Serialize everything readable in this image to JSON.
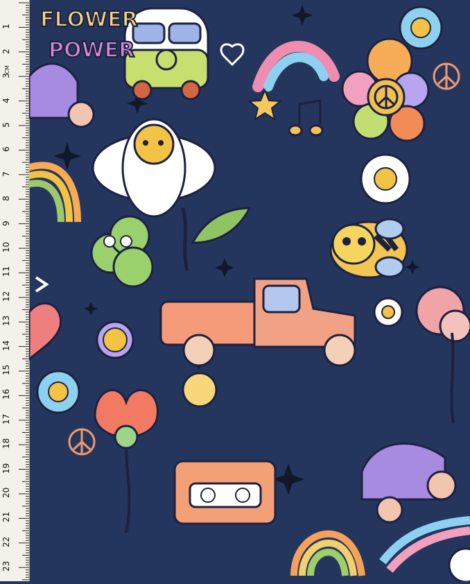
{
  "ruler": {
    "unit": "CM",
    "numbers": [
      "1",
      "2",
      "3",
      "4",
      "5",
      "6",
      "7",
      "8",
      "9",
      "10",
      "11",
      "12",
      "13",
      "14",
      "15",
      "16",
      "17",
      "18",
      "19",
      "20",
      "21",
      "22",
      "23"
    ]
  },
  "artwork": {
    "text_lines": [
      "FLOWER",
      "POWER"
    ]
  },
  "colors": {
    "background": "#24365e",
    "ruler_bg": "#f4f1ea"
  }
}
